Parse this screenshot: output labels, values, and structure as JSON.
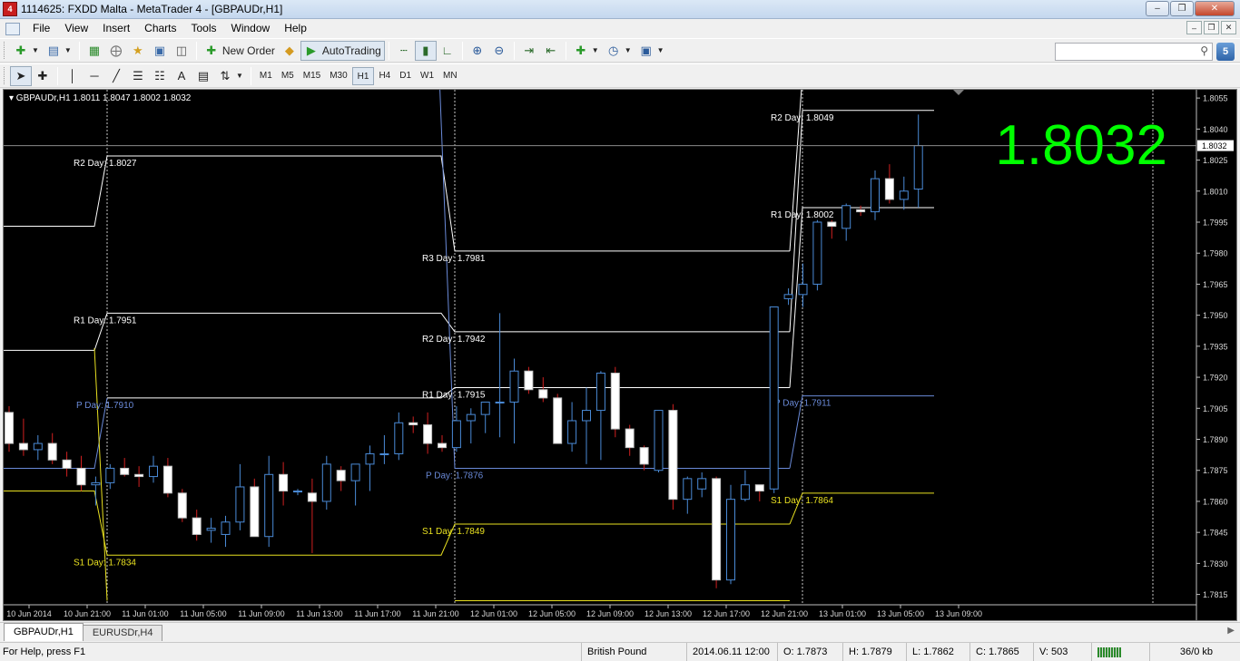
{
  "window": {
    "title": "1114625: FXDD Malta - MetaTrader 4 - [GBPAUDr,H1]"
  },
  "menu": [
    "File",
    "View",
    "Insert",
    "Charts",
    "Tools",
    "Window",
    "Help"
  ],
  "toolbar": {
    "new_order_label": "New Order",
    "autotrading_label": "AutoTrading",
    "search_placeholder": ""
  },
  "timeframes": [
    "M1",
    "M5",
    "M15",
    "M30",
    "H1",
    "H4",
    "D1",
    "W1",
    "MN"
  ],
  "active_timeframe": "H1",
  "chart": {
    "header": "GBPAUDr,H1  1.8011 1.8047 1.8002 1.8032",
    "big_price": "1.8032",
    "current_price_tag": "1.8032",
    "colors": {
      "background": "#000000",
      "bull_body": "#000000",
      "bull_border": "#4a8ad6",
      "bear_body": "#ffffff",
      "bear_border": "#c0c0c0",
      "wick_up": "#4a8ad6",
      "wick_down": "#d02020",
      "pivot": "#6a8ad8",
      "resistance": "#ffffff",
      "support": "#e8e020",
      "big_price": "#00ff00"
    }
  },
  "chart_data": {
    "type": "candlestick",
    "symbol": "GBPAUDr",
    "timeframe": "H1",
    "ylim": [
      1.8105,
      1.81
    ],
    "y_ticks": [
      "1.8055",
      "1.8040",
      "1.8025",
      "1.8010",
      "1.7995",
      "1.7980",
      "1.7965",
      "1.7950",
      "1.7935",
      "1.7920",
      "1.7905",
      "1.7890",
      "1.7875",
      "1.7860",
      "1.7845",
      "1.7830",
      "1.7815"
    ],
    "x_ticks": [
      "10 Jun 2014",
      "10 Jun 21:00",
      "11 Jun 01:00",
      "11 Jun 05:00",
      "11 Jun 09:00",
      "11 Jun 13:00",
      "11 Jun 17:00",
      "11 Jun 21:00",
      "12 Jun 01:00",
      "12 Jun 05:00",
      "12 Jun 09:00",
      "12 Jun 13:00",
      "12 Jun 17:00",
      "12 Jun 21:00",
      "13 Jun 01:00",
      "13 Jun 05:00",
      "13 Jun 09:00"
    ],
    "candles": [
      [
        1.7903,
        1.7906,
        1.7884,
        1.7888
      ],
      [
        1.7888,
        1.79,
        1.7882,
        1.7885
      ],
      [
        1.7885,
        1.7892,
        1.788,
        1.7888
      ],
      [
        1.7888,
        1.7893,
        1.7878,
        1.788
      ],
      [
        1.788,
        1.7884,
        1.7872,
        1.7876
      ],
      [
        1.7876,
        1.7882,
        1.7865,
        1.7868
      ],
      [
        1.7868,
        1.7872,
        1.7858,
        1.7869
      ],
      [
        1.7869,
        1.7878,
        1.7866,
        1.7876
      ],
      [
        1.7876,
        1.7881,
        1.7872,
        1.7873
      ],
      [
        1.7873,
        1.7877,
        1.7867,
        1.7872
      ],
      [
        1.7872,
        1.7882,
        1.7869,
        1.7877
      ],
      [
        1.7877,
        1.7881,
        1.7862,
        1.7864
      ],
      [
        1.7864,
        1.7866,
        1.785,
        1.7852
      ],
      [
        1.7852,
        1.7856,
        1.7841,
        1.7844
      ],
      [
        1.7846,
        1.7852,
        1.784,
        1.7847
      ],
      [
        1.7844,
        1.7853,
        1.7838,
        1.785
      ],
      [
        1.785,
        1.7878,
        1.7846,
        1.7867
      ],
      [
        1.7867,
        1.7871,
        1.7843,
        1.7843
      ],
      [
        1.7843,
        1.7882,
        1.7838,
        1.7873
      ],
      [
        1.7873,
        1.7879,
        1.7858,
        1.7865
      ],
      [
        1.7865,
        1.7866,
        1.7863,
        1.7865
      ],
      [
        1.7864,
        1.7871,
        1.7835,
        1.786
      ],
      [
        1.786,
        1.7882,
        1.7856,
        1.7878
      ],
      [
        1.7875,
        1.7877,
        1.7865,
        1.787
      ],
      [
        1.787,
        1.7878,
        1.7858,
        1.7878
      ],
      [
        1.7878,
        1.7887,
        1.7865,
        1.7883
      ],
      [
        1.7883,
        1.7892,
        1.7878,
        1.7883
      ],
      [
        1.7883,
        1.7903,
        1.788,
        1.7898
      ],
      [
        1.7898,
        1.7901,
        1.7893,
        1.7897
      ],
      [
        1.7897,
        1.7903,
        1.7883,
        1.7888
      ],
      [
        1.7888,
        1.7892,
        1.7884,
        1.7886
      ],
      [
        1.7886,
        1.7906,
        1.7884,
        1.7899
      ],
      [
        1.7899,
        1.7905,
        1.7888,
        1.7902
      ],
      [
        1.7902,
        1.7908,
        1.7893,
        1.7908
      ],
      [
        1.7908,
        1.7951,
        1.7891,
        1.7908
      ],
      [
        1.7908,
        1.7929,
        1.7888,
        1.7923
      ],
      [
        1.7923,
        1.7925,
        1.7912,
        1.7914
      ],
      [
        1.7914,
        1.792,
        1.7908,
        1.791
      ],
      [
        1.791,
        1.7912,
        1.7888,
        1.7888
      ],
      [
        1.7888,
        1.7908,
        1.7884,
        1.7899
      ],
      [
        1.7899,
        1.7915,
        1.7878,
        1.7904
      ],
      [
        1.7904,
        1.7923,
        1.788,
        1.7922
      ],
      [
        1.7922,
        1.7925,
        1.7891,
        1.7895
      ],
      [
        1.7895,
        1.7897,
        1.7882,
        1.7886
      ],
      [
        1.7886,
        1.7887,
        1.7875,
        1.7878
      ],
      [
        1.7875,
        1.7904,
        1.7874,
        1.7904
      ],
      [
        1.7904,
        1.7907,
        1.7856,
        1.7861
      ],
      [
        1.7861,
        1.7872,
        1.7854,
        1.7871
      ],
      [
        1.7866,
        1.7874,
        1.7862,
        1.7871
      ],
      [
        1.7871,
        1.7872,
        1.7818,
        1.7822
      ],
      [
        1.7822,
        1.7868,
        1.782,
        1.7861
      ],
      [
        1.7861,
        1.7875,
        1.786,
        1.7868
      ],
      [
        1.7868,
        1.7868,
        1.786,
        1.7865
      ],
      [
        1.7866,
        1.7954,
        1.7864,
        1.7954
      ],
      [
        1.7958,
        1.7963,
        1.7955,
        1.796
      ],
      [
        1.796,
        1.7975,
        1.7954,
        1.7965
      ],
      [
        1.7965,
        1.7996,
        1.7962,
        1.7995
      ],
      [
        1.7995,
        1.7996,
        1.7987,
        1.7993
      ],
      [
        1.7992,
        1.8004,
        1.7986,
        1.8003
      ],
      [
        1.8001,
        1.8003,
        1.7998,
        1.8
      ],
      [
        1.8,
        1.802,
        1.7996,
        1.8016
      ],
      [
        1.8016,
        1.8023,
        1.8004,
        1.8006
      ],
      [
        1.8006,
        1.8017,
        1.8001,
        1.801
      ],
      [
        1.8011,
        1.8047,
        1.8002,
        1.8032
      ]
    ],
    "pivot_levels": [
      {
        "day": "10 Jun",
        "P": 1.791,
        "R1": 1.7951,
        "R2": 1.8027,
        "S1": 1.7834
      },
      {
        "day": "11 Jun",
        "P": 1.7876,
        "R1": 1.7915,
        "R2": 1.7942,
        "R3": 1.7981,
        "S1": 1.7849
      },
      {
        "day": "12 Jun",
        "P": 1.7911,
        "R1": 1.8002,
        "R2": 1.8049,
        "S1": 1.7864
      }
    ],
    "level_labels": [
      {
        "text": "R2 Day: 1.8027",
        "kind": "resistance"
      },
      {
        "text": "R1 Day: 1.7951",
        "kind": "resistance"
      },
      {
        "text": "P Day: 1.7910",
        "kind": "pivot"
      },
      {
        "text": "S1 Day: 1.7834",
        "kind": "support"
      },
      {
        "text": "R3 Day: 1.7981",
        "kind": "resistance"
      },
      {
        "text": "R2 Day: 1.7942",
        "kind": "resistance"
      },
      {
        "text": "R1 Day: 1.7915",
        "kind": "resistance"
      },
      {
        "text": "P Day: 1.7876",
        "kind": "pivot"
      },
      {
        "text": "S1 Day: 1.7849",
        "kind": "support"
      },
      {
        "text": "R2 Day: 1.8049",
        "kind": "resistance"
      },
      {
        "text": "R1 Day: 1.8002",
        "kind": "resistance"
      },
      {
        "text": "P Day: 1.7911",
        "kind": "pivot"
      },
      {
        "text": "S1 Day: 1.7864",
        "kind": "support"
      }
    ]
  },
  "tabs": [
    "GBPAUDr,H1",
    "EURUSDr,H4"
  ],
  "active_tab": "GBPAUDr,H1",
  "status": {
    "help": "For Help, press F1",
    "instrument": "British Pound",
    "datetime": "2014.06.11 12:00",
    "open": "O: 1.7873",
    "high": "H: 1.7879",
    "low": "L: 1.7862",
    "close": "C: 1.7865",
    "volume": "V: 503",
    "traffic": "36/0 kb"
  }
}
